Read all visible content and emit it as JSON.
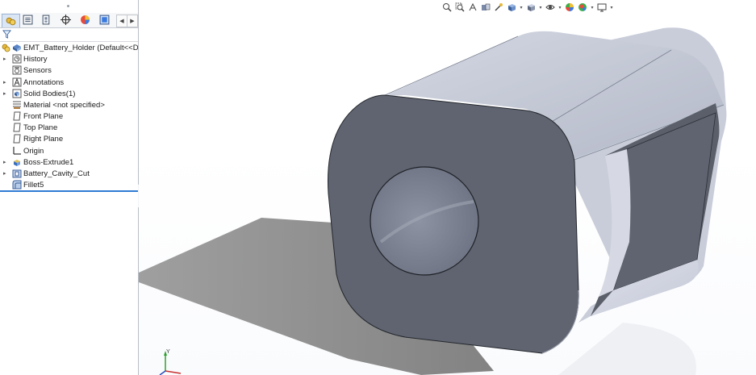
{
  "feature_tree": {
    "root": {
      "label": "EMT_Battery_Holder  (Default<<Def",
      "icon": "part-icon"
    },
    "items": [
      {
        "label": "History",
        "icon": "history-folder-icon",
        "expandable": true
      },
      {
        "label": "Sensors",
        "icon": "sensors-icon",
        "expandable": false
      },
      {
        "label": "Annotations",
        "icon": "annotations-icon",
        "expandable": true
      },
      {
        "label": "Solid Bodies(1)",
        "icon": "solid-bodies-icon",
        "expandable": true
      },
      {
        "label": "Material <not specified>",
        "icon": "material-icon",
        "expandable": false
      },
      {
        "label": "Front Plane",
        "icon": "plane-icon",
        "expandable": false
      },
      {
        "label": "Top Plane",
        "icon": "plane-icon",
        "expandable": false
      },
      {
        "label": "Right Plane",
        "icon": "plane-icon",
        "expandable": false
      },
      {
        "label": "Origin",
        "icon": "origin-icon",
        "expandable": false
      },
      {
        "label": "Boss-Extrude1",
        "icon": "boss-extrude-icon",
        "expandable": true
      },
      {
        "label": "Battery_Cavity_Cut",
        "icon": "cut-extrude-icon",
        "expandable": true
      },
      {
        "label": "Fillet5",
        "icon": "fillet-icon",
        "expandable": false
      }
    ]
  },
  "panel_tabs": [
    {
      "name": "featuremanager-tab-icon",
      "active": true
    },
    {
      "name": "propertymanager-tab-icon",
      "active": false
    },
    {
      "name": "configurationmanager-tab-icon",
      "active": false
    },
    {
      "name": "dimxpert-tab-icon",
      "active": false
    },
    {
      "name": "display-manager-tab-icon",
      "active": false
    },
    {
      "name": "cam-tab-icon",
      "active": false
    }
  ],
  "heads_up_toolbar": [
    "zoom-to-fit-icon",
    "zoom-to-area-icon",
    "previous-view-icon",
    "section-view-icon",
    "dynamic-annotation-icon",
    "view-orientation-icon",
    "display-style-icon",
    "hide-show-items-icon",
    "edit-appearance-icon",
    "apply-scene-icon",
    "view-settings-icon"
  ],
  "colors": {
    "body_face": "#5f6470",
    "body_top": "#c5c9d6",
    "shadow": "#8e8e8e",
    "rollback_bar": "#2f7bd3",
    "triad_y": "#2fa02f",
    "triad_x": "#c83030",
    "triad_z": "#2a4bbd"
  },
  "triad": {
    "y_label": "Y"
  }
}
